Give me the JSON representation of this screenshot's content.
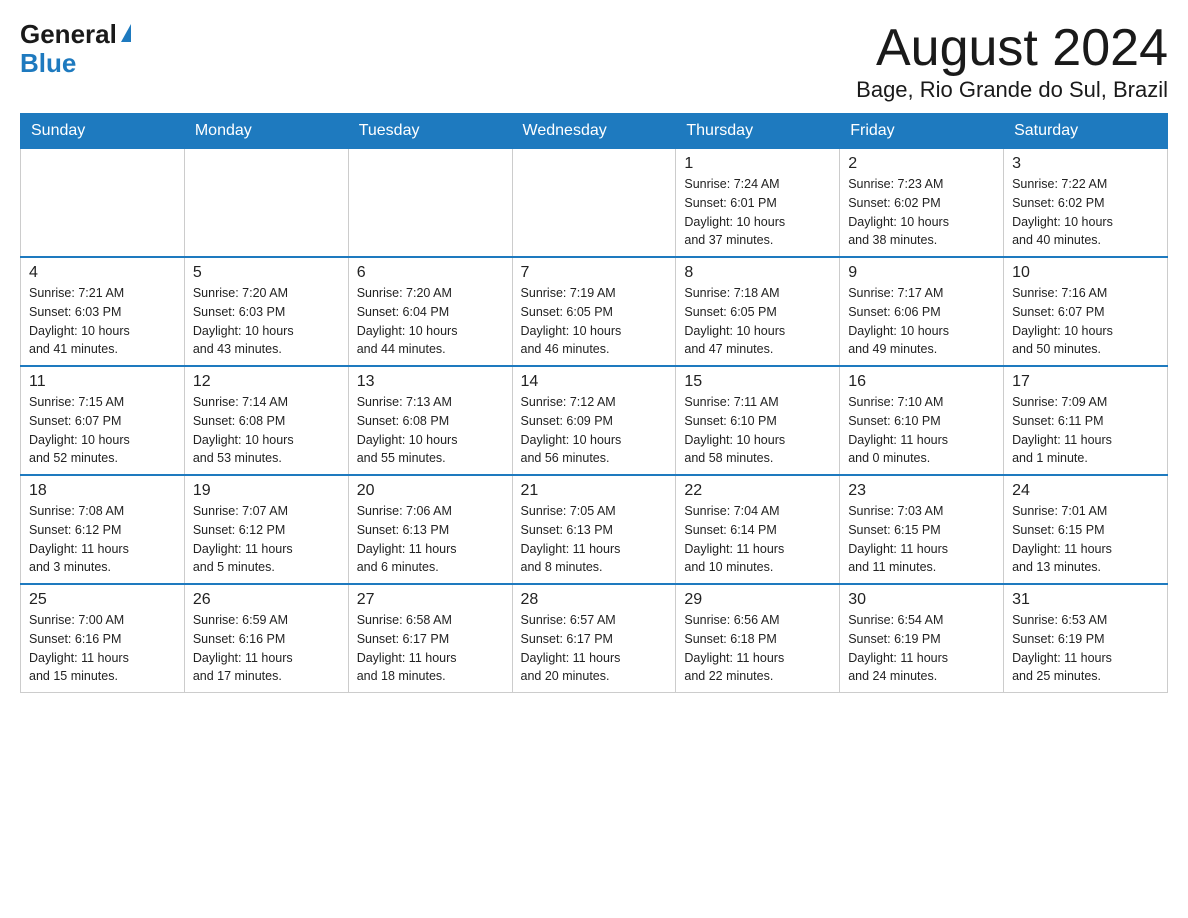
{
  "logo": {
    "general": "General",
    "blue": "Blue"
  },
  "title": "August 2024",
  "location": "Bage, Rio Grande do Sul, Brazil",
  "days_of_week": [
    "Sunday",
    "Monday",
    "Tuesday",
    "Wednesday",
    "Thursday",
    "Friday",
    "Saturday"
  ],
  "weeks": [
    [
      {
        "day": "",
        "info": ""
      },
      {
        "day": "",
        "info": ""
      },
      {
        "day": "",
        "info": ""
      },
      {
        "day": "",
        "info": ""
      },
      {
        "day": "1",
        "info": "Sunrise: 7:24 AM\nSunset: 6:01 PM\nDaylight: 10 hours\nand 37 minutes."
      },
      {
        "day": "2",
        "info": "Sunrise: 7:23 AM\nSunset: 6:02 PM\nDaylight: 10 hours\nand 38 minutes."
      },
      {
        "day": "3",
        "info": "Sunrise: 7:22 AM\nSunset: 6:02 PM\nDaylight: 10 hours\nand 40 minutes."
      }
    ],
    [
      {
        "day": "4",
        "info": "Sunrise: 7:21 AM\nSunset: 6:03 PM\nDaylight: 10 hours\nand 41 minutes."
      },
      {
        "day": "5",
        "info": "Sunrise: 7:20 AM\nSunset: 6:03 PM\nDaylight: 10 hours\nand 43 minutes."
      },
      {
        "day": "6",
        "info": "Sunrise: 7:20 AM\nSunset: 6:04 PM\nDaylight: 10 hours\nand 44 minutes."
      },
      {
        "day": "7",
        "info": "Sunrise: 7:19 AM\nSunset: 6:05 PM\nDaylight: 10 hours\nand 46 minutes."
      },
      {
        "day": "8",
        "info": "Sunrise: 7:18 AM\nSunset: 6:05 PM\nDaylight: 10 hours\nand 47 minutes."
      },
      {
        "day": "9",
        "info": "Sunrise: 7:17 AM\nSunset: 6:06 PM\nDaylight: 10 hours\nand 49 minutes."
      },
      {
        "day": "10",
        "info": "Sunrise: 7:16 AM\nSunset: 6:07 PM\nDaylight: 10 hours\nand 50 minutes."
      }
    ],
    [
      {
        "day": "11",
        "info": "Sunrise: 7:15 AM\nSunset: 6:07 PM\nDaylight: 10 hours\nand 52 minutes."
      },
      {
        "day": "12",
        "info": "Sunrise: 7:14 AM\nSunset: 6:08 PM\nDaylight: 10 hours\nand 53 minutes."
      },
      {
        "day": "13",
        "info": "Sunrise: 7:13 AM\nSunset: 6:08 PM\nDaylight: 10 hours\nand 55 minutes."
      },
      {
        "day": "14",
        "info": "Sunrise: 7:12 AM\nSunset: 6:09 PM\nDaylight: 10 hours\nand 56 minutes."
      },
      {
        "day": "15",
        "info": "Sunrise: 7:11 AM\nSunset: 6:10 PM\nDaylight: 10 hours\nand 58 minutes."
      },
      {
        "day": "16",
        "info": "Sunrise: 7:10 AM\nSunset: 6:10 PM\nDaylight: 11 hours\nand 0 minutes."
      },
      {
        "day": "17",
        "info": "Sunrise: 7:09 AM\nSunset: 6:11 PM\nDaylight: 11 hours\nand 1 minute."
      }
    ],
    [
      {
        "day": "18",
        "info": "Sunrise: 7:08 AM\nSunset: 6:12 PM\nDaylight: 11 hours\nand 3 minutes."
      },
      {
        "day": "19",
        "info": "Sunrise: 7:07 AM\nSunset: 6:12 PM\nDaylight: 11 hours\nand 5 minutes."
      },
      {
        "day": "20",
        "info": "Sunrise: 7:06 AM\nSunset: 6:13 PM\nDaylight: 11 hours\nand 6 minutes."
      },
      {
        "day": "21",
        "info": "Sunrise: 7:05 AM\nSunset: 6:13 PM\nDaylight: 11 hours\nand 8 minutes."
      },
      {
        "day": "22",
        "info": "Sunrise: 7:04 AM\nSunset: 6:14 PM\nDaylight: 11 hours\nand 10 minutes."
      },
      {
        "day": "23",
        "info": "Sunrise: 7:03 AM\nSunset: 6:15 PM\nDaylight: 11 hours\nand 11 minutes."
      },
      {
        "day": "24",
        "info": "Sunrise: 7:01 AM\nSunset: 6:15 PM\nDaylight: 11 hours\nand 13 minutes."
      }
    ],
    [
      {
        "day": "25",
        "info": "Sunrise: 7:00 AM\nSunset: 6:16 PM\nDaylight: 11 hours\nand 15 minutes."
      },
      {
        "day": "26",
        "info": "Sunrise: 6:59 AM\nSunset: 6:16 PM\nDaylight: 11 hours\nand 17 minutes."
      },
      {
        "day": "27",
        "info": "Sunrise: 6:58 AM\nSunset: 6:17 PM\nDaylight: 11 hours\nand 18 minutes."
      },
      {
        "day": "28",
        "info": "Sunrise: 6:57 AM\nSunset: 6:17 PM\nDaylight: 11 hours\nand 20 minutes."
      },
      {
        "day": "29",
        "info": "Sunrise: 6:56 AM\nSunset: 6:18 PM\nDaylight: 11 hours\nand 22 minutes."
      },
      {
        "day": "30",
        "info": "Sunrise: 6:54 AM\nSunset: 6:19 PM\nDaylight: 11 hours\nand 24 minutes."
      },
      {
        "day": "31",
        "info": "Sunrise: 6:53 AM\nSunset: 6:19 PM\nDaylight: 11 hours\nand 25 minutes."
      }
    ]
  ]
}
